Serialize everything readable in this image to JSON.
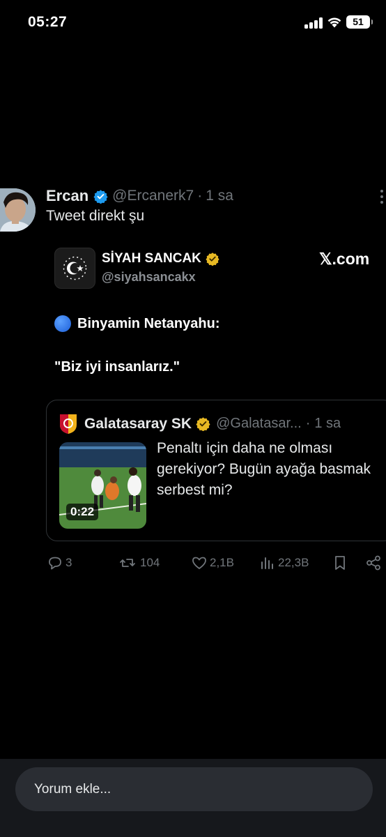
{
  "status_bar": {
    "time": "05:27",
    "battery": "51"
  },
  "tweet": {
    "author_name": "Ercan",
    "author_handle": "@Ercanerk7",
    "separator": "·",
    "time": "1 sa",
    "text": "Tweet direkt şu",
    "verified_color": "#1d9bf0"
  },
  "embedded_screenshot": {
    "account_name": "SİYAH SANCAK",
    "account_handle": "@siyahsancakx",
    "brand": "𝕏.com",
    "line1": "Binyamin Netanyahu:",
    "line2": "\"Biz iyi insanlarız.\"",
    "badge_color": "#e8b923"
  },
  "quoted_tweet": {
    "author_name": "Galatasaray SK",
    "author_handle": "@Galatasar...",
    "separator": "·",
    "time": "1 sa",
    "text": "Penaltı için daha ne olması gerekiyor? Bugün ayağa basmak serbest mi?",
    "video_duration": "0:22"
  },
  "actions": {
    "replies": "3",
    "retweets": "104",
    "likes": "2,1B",
    "views": "22,3B"
  },
  "comment": {
    "placeholder": "Yorum ekle..."
  }
}
